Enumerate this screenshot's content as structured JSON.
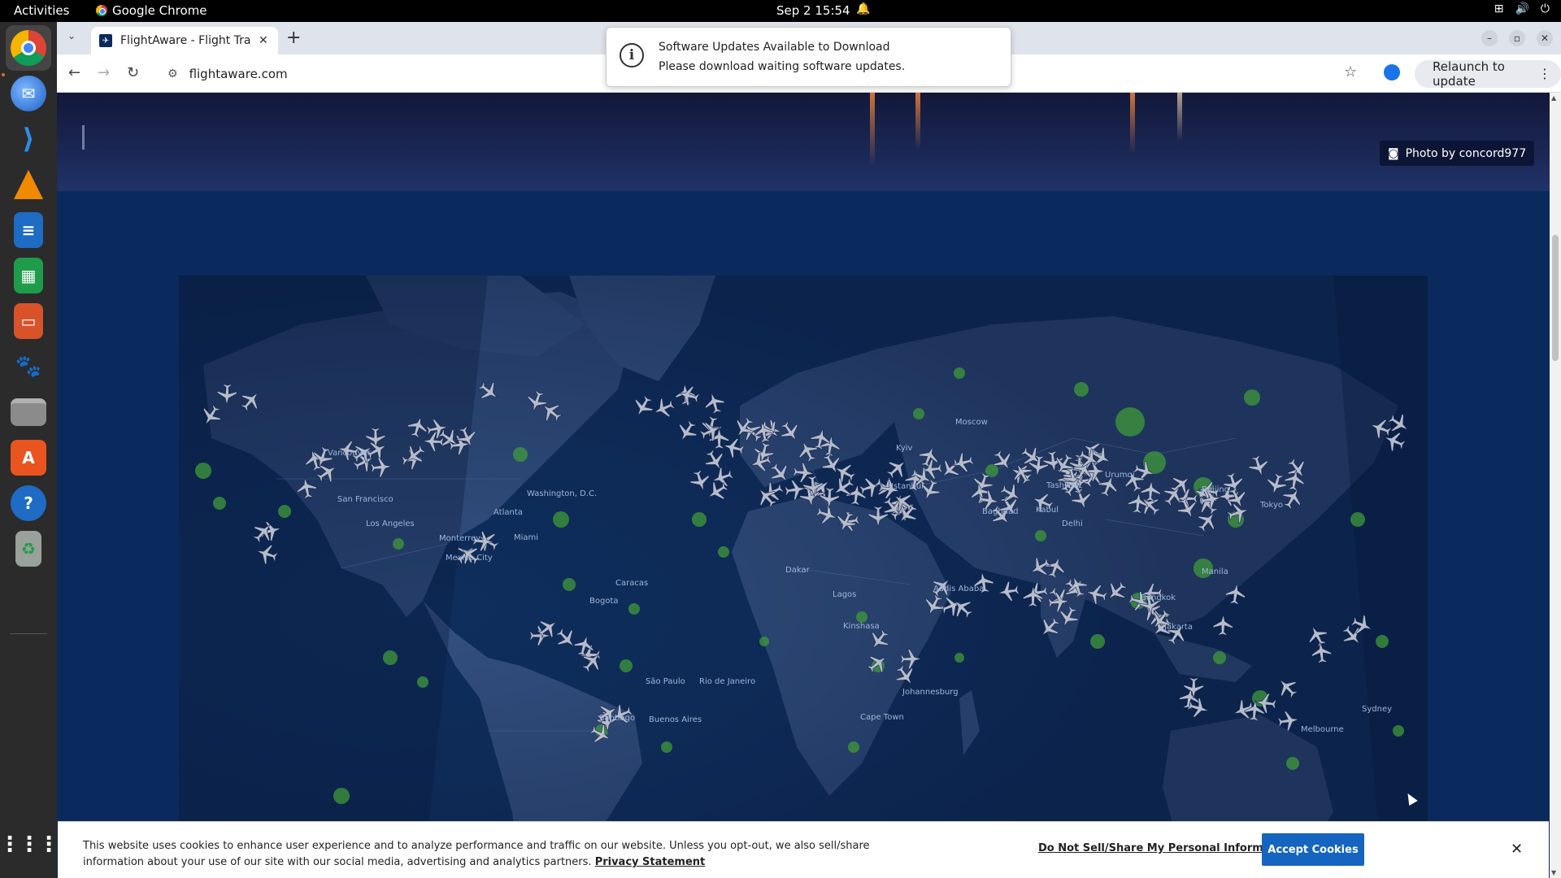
{
  "topbar": {
    "activities": "Activities",
    "app_name": "Google Chrome",
    "clock": "Sep 2  15:54"
  },
  "dock": {
    "items": [
      {
        "name": "chrome",
        "color": "#db4437"
      },
      {
        "name": "thunderbird",
        "color": "#2a6cc9"
      },
      {
        "name": "vscode",
        "color": "#1f7acb"
      },
      {
        "name": "vlc",
        "color": "#f08a00"
      },
      {
        "name": "writer",
        "color": "#1e6cc4"
      },
      {
        "name": "calc",
        "color": "#1e9c4a"
      },
      {
        "name": "impress",
        "color": "#d8532a"
      },
      {
        "name": "gimp",
        "color": "#6f6a5d"
      },
      {
        "name": "files",
        "color": "#8b8b8b"
      },
      {
        "name": "software",
        "color": "#e9541f"
      },
      {
        "name": "help",
        "color": "#1e6cc4"
      },
      {
        "name": "trash",
        "color": "#9aa09a"
      }
    ]
  },
  "browser": {
    "tab_title": "FlightAware - Flight Trac",
    "url": "flightaware.com",
    "relaunch_label": "Relaunch to update"
  },
  "notification": {
    "title": "Software Updates Available to Download",
    "body": "Please download waiting software updates."
  },
  "hero": {
    "photo_credit": "Photo by concord977"
  },
  "map": {
    "cities": [
      "Vancouver",
      "San Francisco",
      "Los Angeles",
      "Washington, D.C.",
      "Atlanta",
      "Miami",
      "Monterrey",
      "Mexico City",
      "Caracas",
      "Bogota",
      "São Paulo",
      "Rio de Janeiro",
      "Santiago",
      "Buenos Aires",
      "Dakar",
      "Lagos",
      "Kinshasa",
      "Johannesburg",
      "Cape Town",
      "Addis Ababa",
      "Istanbul",
      "Kyiv",
      "Moscow",
      "Baghdad",
      "Tashkent",
      "Kabul",
      "Delhi",
      "Urumqi",
      "Beijing",
      "Tokyo",
      "Bangkok",
      "Manila",
      "Jakarta",
      "Melbourne",
      "Sydney"
    ],
    "colors": {
      "ocean": "#0f2e5c",
      "land": "#34507f",
      "weather": "#3f9a3a",
      "plane": "#b7bccb"
    }
  },
  "cookie": {
    "message": "This website uses cookies to enhance user experience and to analyze performance and traffic on our website. Unless you opt-out, we also sell/share information about your use of our site with our social media, advertising and analytics partners.",
    "privacy_link": "Privacy Statement",
    "do_not_sell": "Do Not Sell/Share My Personal Information",
    "accept": "Accept Cookies"
  }
}
